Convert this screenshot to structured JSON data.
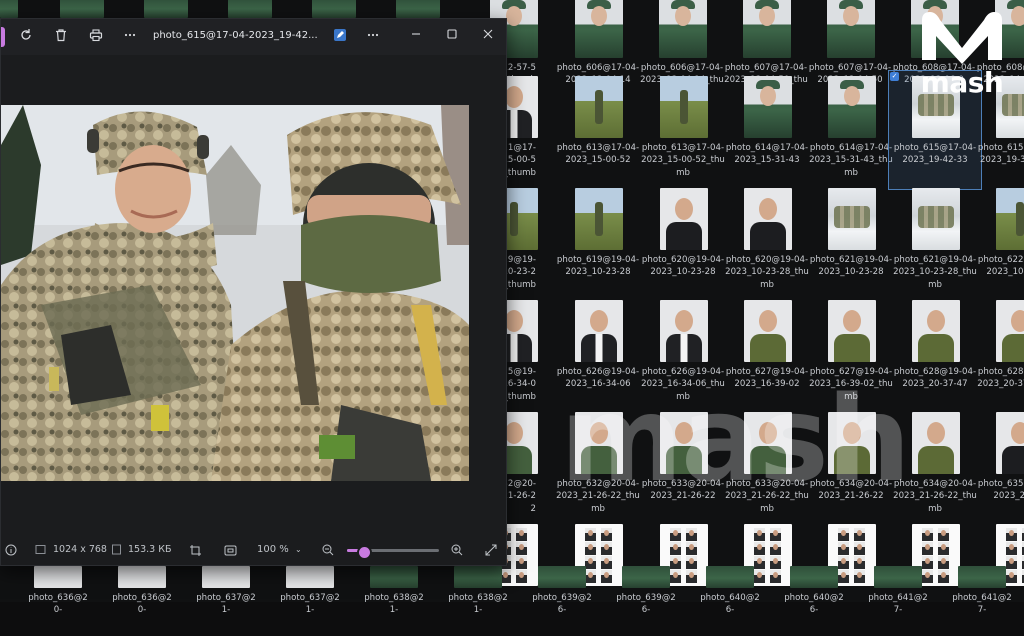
{
  "viewer": {
    "title": "photo_615@17-04-2023_19-42...",
    "toolbar_icons": [
      "rotate-icon",
      "delete-icon",
      "print-icon",
      "more-icon"
    ],
    "window_icons": [
      "edit-icon",
      "more-icon",
      "minimize-icon",
      "maximize-icon",
      "close-icon"
    ],
    "status": {
      "dimensions": "1024 x 768",
      "filesize": "153.3 КБ",
      "zoom": "100 %",
      "zoom_fraction": 0.18
    }
  },
  "logo": {
    "text": "mash"
  },
  "watermark": {
    "text": "mash"
  },
  "accent_color": "#c87be0",
  "explorer": {
    "rows": [
      {
        "tiles": [
          {
            "caption": "",
            "thumb": "uniform",
            "partial": true
          },
          {
            "caption": "photo_606@17-04-2023_13-04-14",
            "thumb": "uniform"
          },
          {
            "caption": "photo_606@17-04-2023_13-04-14_thumb",
            "thumb": "uniform"
          },
          {
            "caption": "photo_607@17-04-2023_13-04-50_thumb",
            "thumb": "uniform"
          },
          {
            "caption": "photo_607@17-04-2023_13-04-50",
            "thumb": "uniform"
          },
          {
            "caption": "photo_608@17-04-2023_13-06-0",
            "thumb": "uniform"
          },
          {
            "caption": "photo_608@17-04-2023_14_thumb",
            "thumb": "uniform"
          }
        ],
        "left_caption": "12-57-5\n4_thumb"
      },
      {
        "tiles": [
          {
            "caption": "photo_613@17-04-2023_15-00-52",
            "thumb": "field"
          },
          {
            "caption": "photo_613@17-04-2023_15-00-52_thumb",
            "thumb": "field"
          },
          {
            "caption": "photo_614@17-04-2023_15-31-43",
            "thumb": "uniform"
          },
          {
            "caption": "photo_614@17-04-2023_15-31-43_thumb",
            "thumb": "uniform"
          },
          {
            "caption": "photo_615@17-04-2023_19-42-33",
            "thumb": "snow",
            "selected": true
          },
          {
            "caption": "photo_615@19-04-2023_19-3_thumb",
            "thumb": "snow"
          }
        ],
        "left_caption": "11@17-\n15-00-5\n2_thumb"
      },
      {
        "tiles": [
          {
            "caption": "photo_619@19-04-2023_10-23-28",
            "thumb": "field"
          },
          {
            "caption": "photo_620@19-04-2023_10-23-28",
            "thumb": "face-dark"
          },
          {
            "caption": "photo_620@19-04-2023_10-23-28_thumb",
            "thumb": "face-dark"
          },
          {
            "caption": "photo_621@19-04-2023_10-23-28",
            "thumb": "snow"
          },
          {
            "caption": "photo_621@19-04-2023_10-23-28_thumb",
            "thumb": "snow"
          },
          {
            "caption": "photo_622@19-04-2023_10-23-28",
            "thumb": "field"
          }
        ],
        "left_caption": "19@19-\n10-23-2\n8_thumb"
      },
      {
        "tiles": [
          {
            "caption": "photo_626@19-04-2023_16-34-06",
            "thumb": "face-shirt"
          },
          {
            "caption": "photo_626@19-04-2023_16-34-06_thumb",
            "thumb": "face-shirt"
          },
          {
            "caption": "photo_627@19-04-2023_16-39-02",
            "thumb": "face-olive"
          },
          {
            "caption": "photo_627@19-04-2023_16-39-02_thumb",
            "thumb": "face-olive"
          },
          {
            "caption": "photo_628@19-04-2023_20-37-47",
            "thumb": "face-olive"
          },
          {
            "caption": "photo_628@19-04-2023_20-37_thumb",
            "thumb": "face-olive"
          }
        ],
        "left_caption": "25@19-\n16-34-0\n6_thumb"
      },
      {
        "tiles": [
          {
            "caption": "photo_632@20-04-2023_21-26-22_thumb",
            "thumb": "face-green"
          },
          {
            "caption": "photo_633@20-04-2023_21-26-22",
            "thumb": "face-green"
          },
          {
            "caption": "photo_633@20-04-2023_21-26-22_thumb",
            "thumb": "face-green"
          },
          {
            "caption": "photo_634@20-04-2023_21-26-22",
            "thumb": "face-olive"
          },
          {
            "caption": "photo_634@20-04-2023_21-26-22_thumb",
            "thumb": "face-olive"
          },
          {
            "caption": "photo_635@20-04-2023_21-26",
            "thumb": "face-dark"
          }
        ],
        "left_caption": "32@20-\n21-26-2\n2"
      },
      {
        "tiles": [
          {
            "caption": "",
            "thumb": "sheet"
          },
          {
            "caption": "",
            "thumb": "sheet"
          },
          {
            "caption": "",
            "thumb": "sheet"
          },
          {
            "caption": "",
            "thumb": "sheet"
          },
          {
            "caption": "",
            "thumb": "sheet"
          },
          {
            "caption": "",
            "thumb": "sheet"
          }
        ],
        "left_caption": ""
      }
    ],
    "bottom_strip": [
      "photo_636@20-",
      "photo_636@20-",
      "photo_637@21-",
      "photo_637@21-",
      "photo_638@21-",
      "photo_638@21-",
      "photo_639@26-",
      "photo_639@26-",
      "photo_640@26-",
      "photo_640@26-",
      "photo_641@27-",
      "photo_641@27-"
    ]
  }
}
